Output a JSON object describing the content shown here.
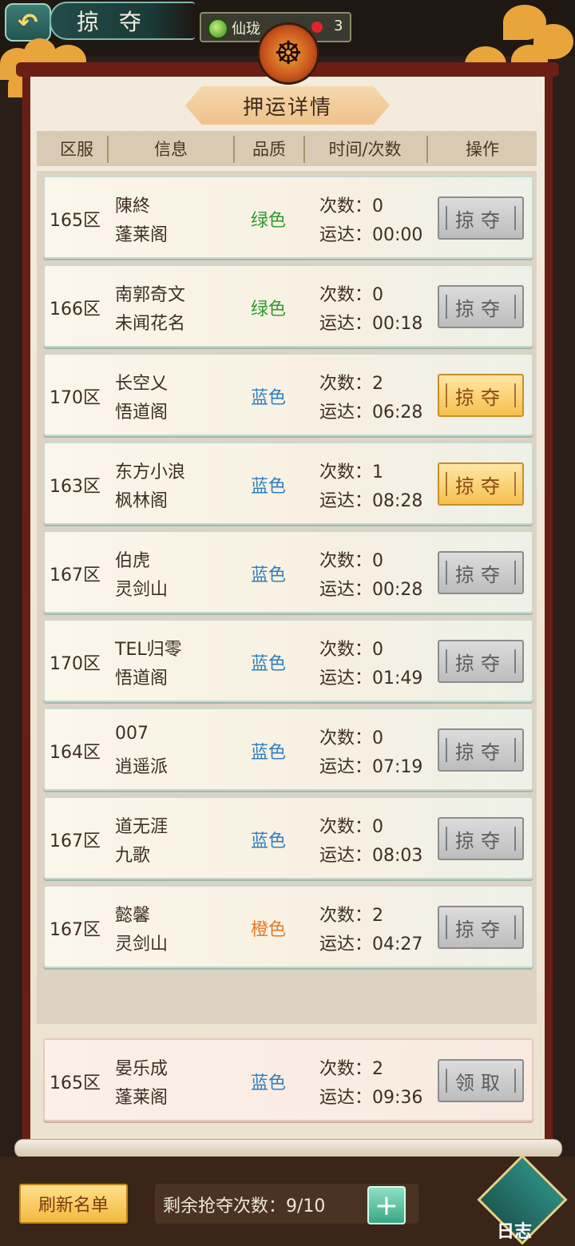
{
  "header": {
    "back_icon": "back-arrow-icon",
    "title": "掠 夺",
    "currency": {
      "icon": "jade-icon",
      "name": "仙珑",
      "count": "3"
    }
  },
  "panel": {
    "title": "押运详情",
    "columns": [
      "区服",
      "信息",
      "品质",
      "时间/次数",
      "操作"
    ]
  },
  "rows": [
    {
      "zone": "165区",
      "name": "陳終",
      "guild": "蓬莱阁",
      "quality": "绿色",
      "quality_color": "#2f9a2f",
      "count": "次数：0",
      "eta": "运达：00:00",
      "action": "掠夺",
      "state": "disabled"
    },
    {
      "zone": "166区",
      "name": "南郭奇文",
      "guild": "未闻花名",
      "quality": "绿色",
      "quality_color": "#2f9a2f",
      "count": "次数：0",
      "eta": "运达：00:18",
      "action": "掠夺",
      "state": "disabled"
    },
    {
      "zone": "170区",
      "name": "长空乂",
      "guild": "悟道阁",
      "quality": "蓝色",
      "quality_color": "#2f7fc0",
      "count": "次数：2",
      "eta": "运达：06:28",
      "action": "掠夺",
      "state": "active"
    },
    {
      "zone": "163区",
      "name": "东方小浪",
      "guild": "枫林阁",
      "quality": "蓝色",
      "quality_color": "#2f7fc0",
      "count": "次数：1",
      "eta": "运达：08:28",
      "action": "掠夺",
      "state": "active"
    },
    {
      "zone": "167区",
      "name": "伯虎",
      "guild": "灵剑山",
      "quality": "蓝色",
      "quality_color": "#2f7fc0",
      "count": "次数：0",
      "eta": "运达：00:28",
      "action": "掠夺",
      "state": "disabled"
    },
    {
      "zone": "170区",
      "name": "TEL归零",
      "guild": "悟道阁",
      "quality": "蓝色",
      "quality_color": "#2f7fc0",
      "count": "次数：0",
      "eta": "运达：01:49",
      "action": "掠夺",
      "state": "disabled"
    },
    {
      "zone": "164区",
      "name": "007",
      "guild": "逍遥派",
      "quality": "蓝色",
      "quality_color": "#2f7fc0",
      "count": "次数：0",
      "eta": "运达：07:19",
      "action": "掠夺",
      "state": "disabled"
    },
    {
      "zone": "167区",
      "name": "道无涯",
      "guild": "九歌",
      "quality": "蓝色",
      "quality_color": "#2f7fc0",
      "count": "次数：0",
      "eta": "运达：08:03",
      "action": "掠夺",
      "state": "disabled"
    },
    {
      "zone": "167区",
      "name": "懿馨",
      "guild": "灵剑山",
      "quality": "橙色",
      "quality_color": "#e07b2b",
      "count": "次数：2",
      "eta": "运达：04:27",
      "action": "掠夺",
      "state": "disabled"
    }
  ],
  "self_row": {
    "zone": "165区",
    "name": "晏乐成",
    "guild": "蓬莱阁",
    "quality": "蓝色",
    "quality_color": "#2f7fc0",
    "count": "次数：2",
    "eta": "运达：09:36",
    "action": "领取",
    "state": "disabled"
  },
  "footer": {
    "refresh_label": "刷新名单",
    "remaining_label": "剩余抢夺次数：9/10",
    "plus_icon": "plus-icon",
    "log_label": "日志",
    "log_icon": "scroll-icon"
  }
}
